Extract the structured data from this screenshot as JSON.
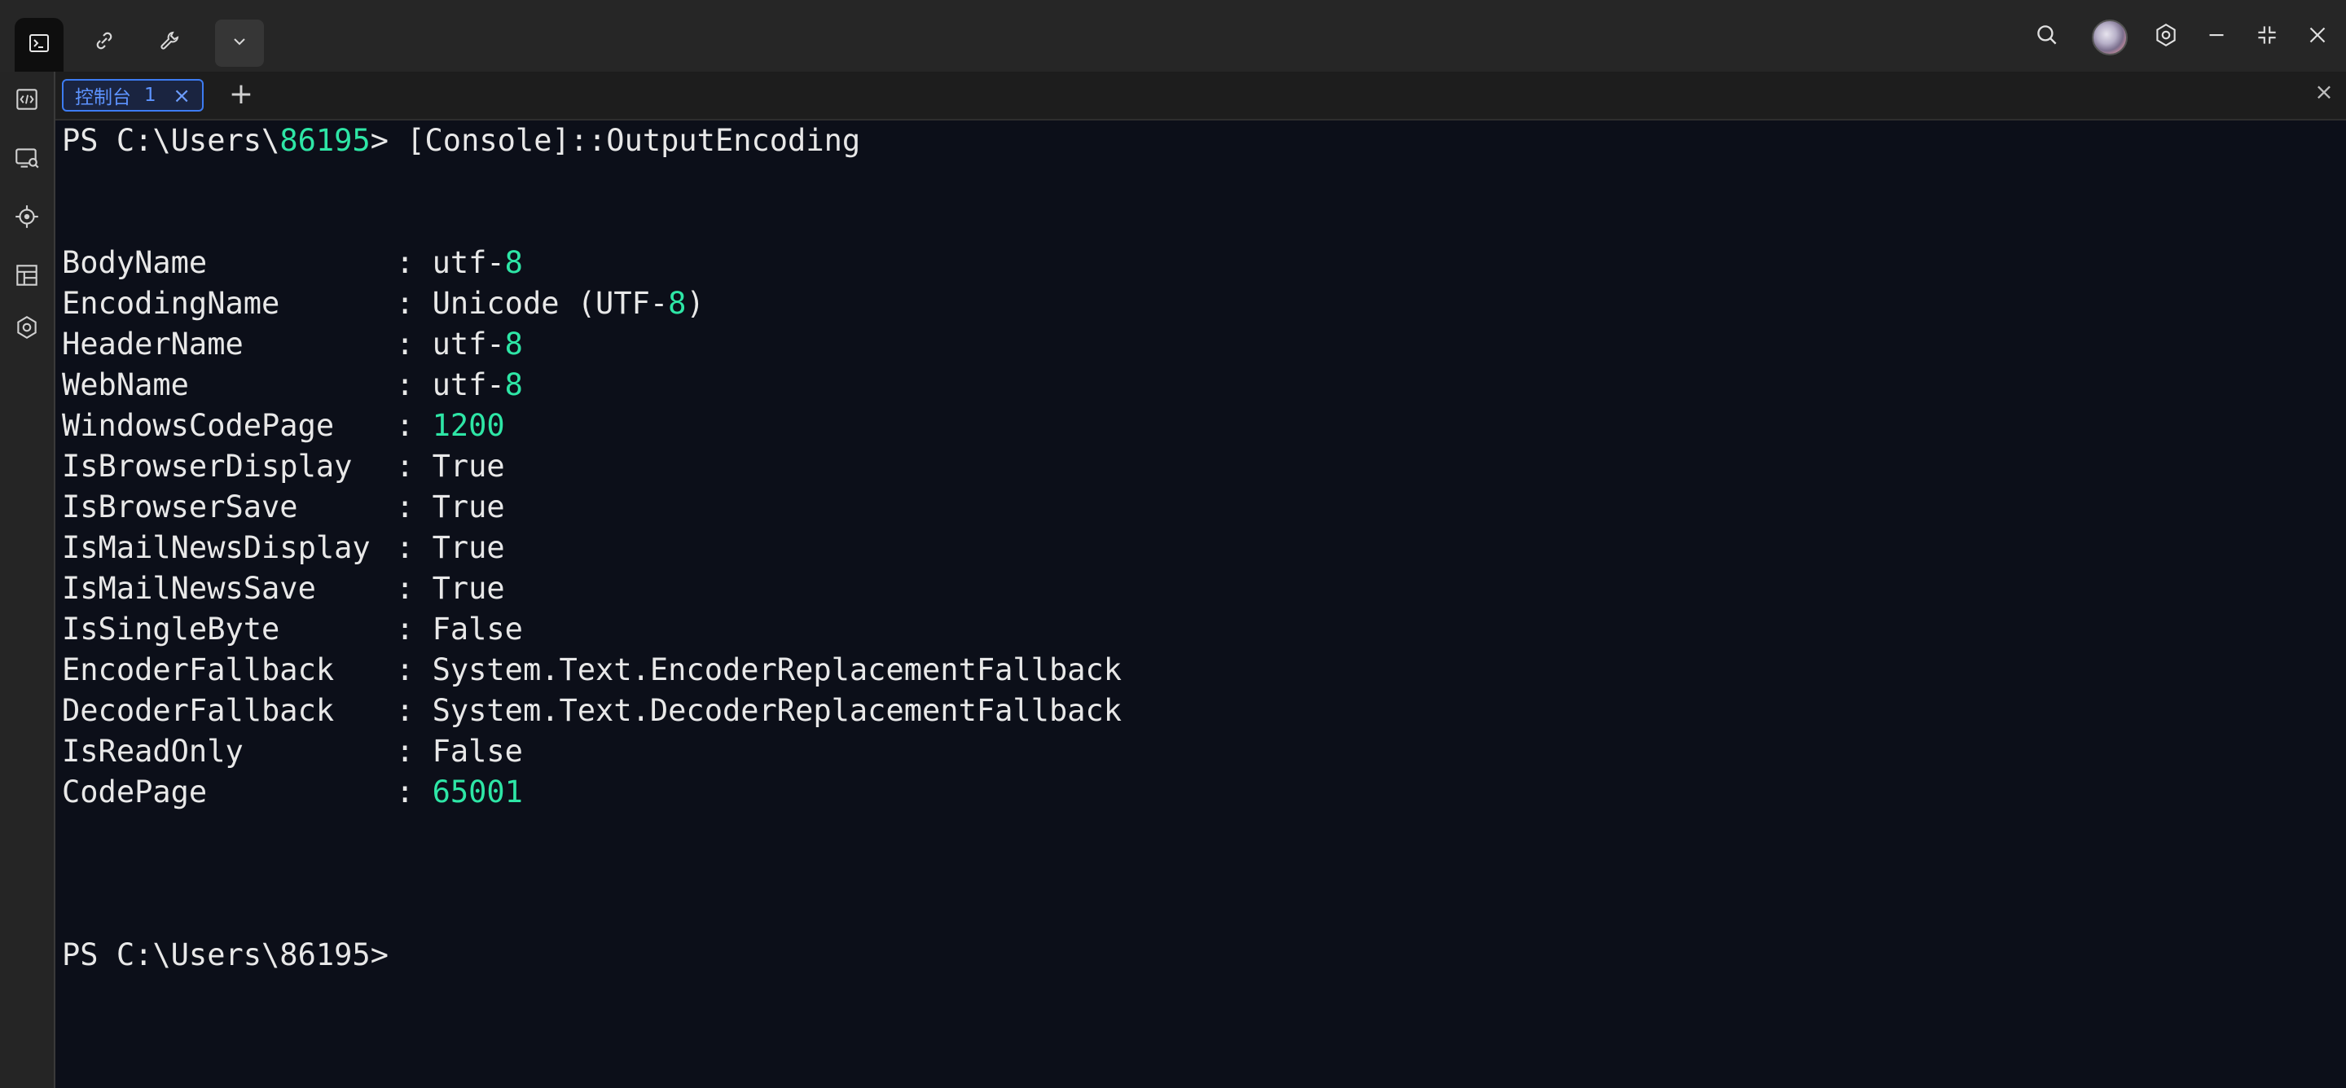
{
  "titlebar": {
    "left_buttons": [
      {
        "icon": "terminal-icon",
        "active": true
      },
      {
        "icon": "link-icon",
        "active": false
      },
      {
        "icon": "wrench-icon",
        "active": false
      },
      {
        "icon": "chevron-down-icon",
        "active": false
      }
    ],
    "right_icons": [
      "search-icon",
      "avatar",
      "settings-icon",
      "minimize-icon",
      "restore-icon",
      "close-icon"
    ]
  },
  "sidebar": {
    "items": [
      "code-icon",
      "screen-search-icon",
      "target-icon",
      "layout-icon",
      "hexagon-settings-icon"
    ]
  },
  "tabs": {
    "items": [
      {
        "label": "控制台",
        "number": "1",
        "close": "×"
      }
    ],
    "add_label": "+",
    "panel_close": "×"
  },
  "terminal": {
    "prompt_path": "PS C:\\Users\\",
    "prompt_user": "86195",
    "prompt_suffix": ">",
    "command": " [Console]::OutputEncoding",
    "rows": [
      {
        "name": "BodyName",
        "value_text": "utf-",
        "value_num": "8",
        "value_tail": ""
      },
      {
        "name": "EncodingName",
        "value_text": "Unicode (UTF-",
        "value_num": "8",
        "value_tail": ")"
      },
      {
        "name": "HeaderName",
        "value_text": "utf-",
        "value_num": "8",
        "value_tail": ""
      },
      {
        "name": "WebName",
        "value_text": "utf-",
        "value_num": "8",
        "value_tail": ""
      },
      {
        "name": "WindowsCodePage",
        "value_text": "",
        "value_num": "1200",
        "value_tail": ""
      },
      {
        "name": "IsBrowserDisplay",
        "value_text": "True",
        "value_num": "",
        "value_tail": ""
      },
      {
        "name": "IsBrowserSave",
        "value_text": "True",
        "value_num": "",
        "value_tail": ""
      },
      {
        "name": "IsMailNewsDisplay",
        "value_text": "True",
        "value_num": "",
        "value_tail": ""
      },
      {
        "name": "IsMailNewsSave",
        "value_text": "True",
        "value_num": "",
        "value_tail": ""
      },
      {
        "name": "IsSingleByte",
        "value_text": "False",
        "value_num": "",
        "value_tail": ""
      },
      {
        "name": "EncoderFallback",
        "value_text": "System.Text.EncoderReplacementFallback",
        "value_num": "",
        "value_tail": ""
      },
      {
        "name": "DecoderFallback",
        "value_text": "System.Text.DecoderReplacementFallback",
        "value_num": "",
        "value_tail": ""
      },
      {
        "name": "IsReadOnly",
        "value_text": "False",
        "value_num": "",
        "value_tail": ""
      },
      {
        "name": "CodePage",
        "value_text": "",
        "value_num": "65001",
        "value_tail": ""
      }
    ],
    "separator": ": ",
    "final_prompt": "PS C:\\Users\\86195>"
  },
  "colors": {
    "background": "#0c0f19",
    "text": "#e8e8e8",
    "number": "#2ee6a6",
    "accent": "#3d7cf2"
  }
}
